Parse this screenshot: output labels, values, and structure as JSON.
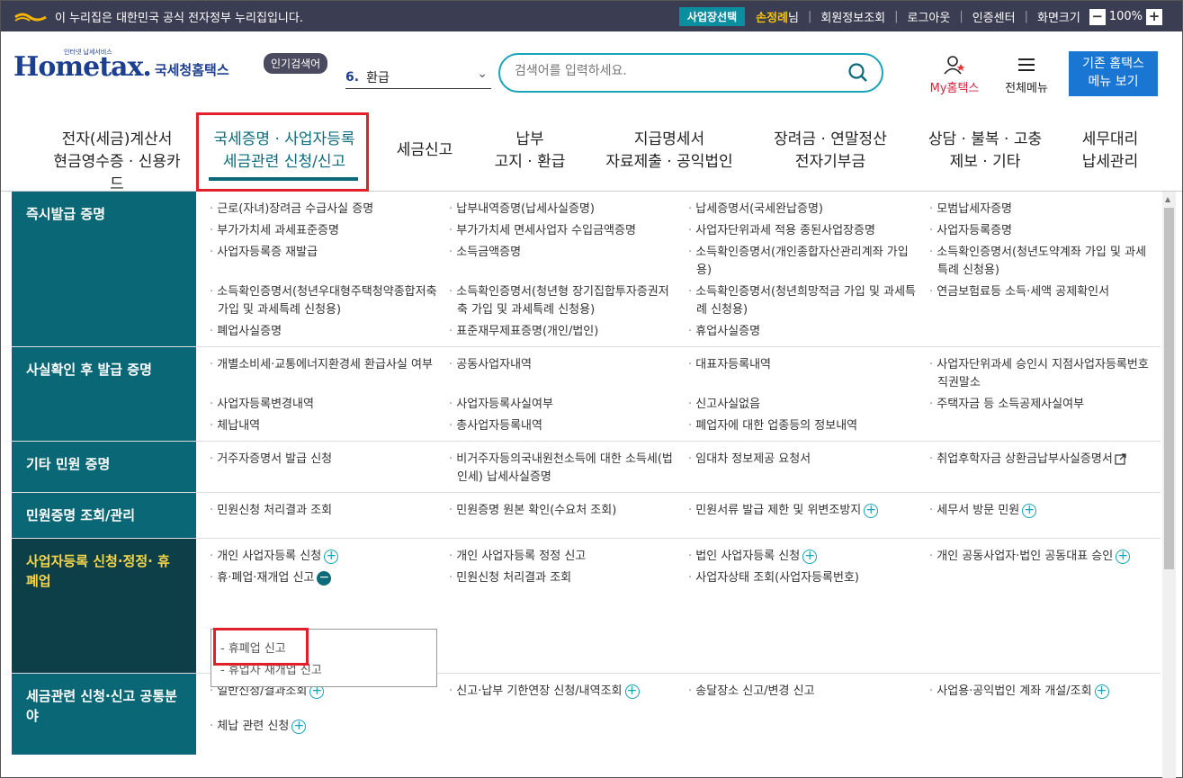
{
  "topbar": {
    "gov_notice": "이 누리집은 대한민국 공식 전자정부 누리집입니다.",
    "business_select": "사업장선택",
    "user_name": "손정례",
    "user_suffix": "님",
    "member_info": "회원정보조회",
    "logout": "로그아웃",
    "cert_center": "인증센터",
    "screen_size": "화면크기",
    "zoom": "100%"
  },
  "header": {
    "logo_small": "인터넷 납세서비스",
    "logo_home": "Home",
    "logo_tax": "tax.",
    "logo_kor": "국세청홈택스",
    "popular_label": "인기검색어",
    "popular_num": "6.",
    "popular_value": "환급",
    "search_placeholder": "검색어를 입력하세요.",
    "my_home": "My홈택스",
    "all_menu": "전체메뉴",
    "old_hometax_line1": "기존 홈택스",
    "old_hometax_line2": "메뉴 보기"
  },
  "gnb": [
    {
      "l1": "전자(세금)계산서",
      "l2": "현금영수증 · 신용카드"
    },
    {
      "l1": "국세증명 · 사업자등록",
      "l2": "세금관련 신청/신고"
    },
    {
      "l1": "세금신고",
      "l2": ""
    },
    {
      "l1": "납부",
      "l2": "고지 · 환급"
    },
    {
      "l1": "지급명세서",
      "l2": "자료제출 · 공익법인"
    },
    {
      "l1": "장려금 · 연말정산",
      "l2": "전자기부금"
    },
    {
      "l1": "상담 · 불복 · 고충",
      "l2": "제보 · 기타"
    },
    {
      "l1": "세무대리",
      "l2": "납세관리"
    }
  ],
  "sections": [
    {
      "title": "즉시발급 증명",
      "items": [
        "근로(자녀)장려금 수급사실 증명",
        "납부내역증명(납세사실증명)",
        "납세증명서(국세완납증명)",
        "모범납세자증명",
        "부가가치세 과세표준증명",
        "부가가치세 면세사업자 수입금액증명",
        "사업자단위과세 적용 종된사업장증명",
        "사업자등록증명",
        "사업자등록증 재발급",
        "소득금액증명",
        "소득확인증명서(개인종합자산관리계좌 가입용)",
        "소득확인증명서(청년도약계좌 가입 및 과세특례 신청용)",
        "소득확인증명서(청년우대형주택청약종합저축 가입 및 과세특례 신청용)",
        "소득확인증명서(청년형 장기집합투자증권저축 가입 및 과세특례 신청용)",
        "소득확인증명서(청년희망적금 가입 및 과세특례 신청용)",
        "연금보험료등 소득·세액 공제확인서",
        "폐업사실증명",
        "표준재무제표증명(개인/법인)",
        "휴업사실증명"
      ]
    },
    {
      "title": "사실확인 후 발급 증명",
      "items": [
        "개별소비세·교통에너지환경세 환급사실 여부",
        "공동사업자내역",
        "대표자등록내역",
        "사업자단위과세 승인시 지점사업자등록번호 직권말소",
        "사업자등록변경내역",
        "사업자등록사실여부",
        "신고사실없음",
        "주택자금 등 소득공제사실여부",
        "체납내역",
        "총사업자등록내역",
        "폐업자에 대한 업종등의 정보내역"
      ]
    },
    {
      "title": "기타 민원 증명",
      "items": [
        "거주자증명서 발급 신청",
        "비거주자등의국내원천소득에 대한 소득세(법인세) 납세사실증명",
        "임대차 정보제공 요청서",
        "취업후학자금 상환금납부사실증명서"
      ]
    },
    {
      "title": "민원증명 조회/관리",
      "items": [
        "민원신청 처리결과 조회",
        "민원증명 원본 확인(수요처 조회)",
        "민원서류 발급 제한 및 위변조방지",
        "세무서 방문 민원"
      ]
    },
    {
      "title": "사업자등록 신청·정정· 휴폐업",
      "items": [
        "개인 사업자등록 신청",
        "개인 사업자등록 정정 신고",
        "법인 사업자등록 신청",
        "개인 공동사업자·법인 공동대표 승인",
        "휴·폐업·재개업 신고",
        "민원신청 처리결과 조회",
        "사업자상태 조회(사업자등록번호)"
      ],
      "submenu": [
        "휴폐업 신고",
        "휴업자 재개업 신고"
      ]
    },
    {
      "title": "세금관련 신청·신고 공통분야",
      "items": [
        "일반신청/결과조회",
        "신고·납부 기한연장 신청/내역조회",
        "송달장소 신고/변경 신고",
        "사업용·공익법인 계좌 개설/조회",
        "체납 관련 신청"
      ]
    }
  ],
  "colors": {
    "topbar": "#3b3d52",
    "teal": "#0a6775",
    "active_label": "#f5d64a",
    "highlight": "#e0202a",
    "accent": "#1aa4b8"
  }
}
